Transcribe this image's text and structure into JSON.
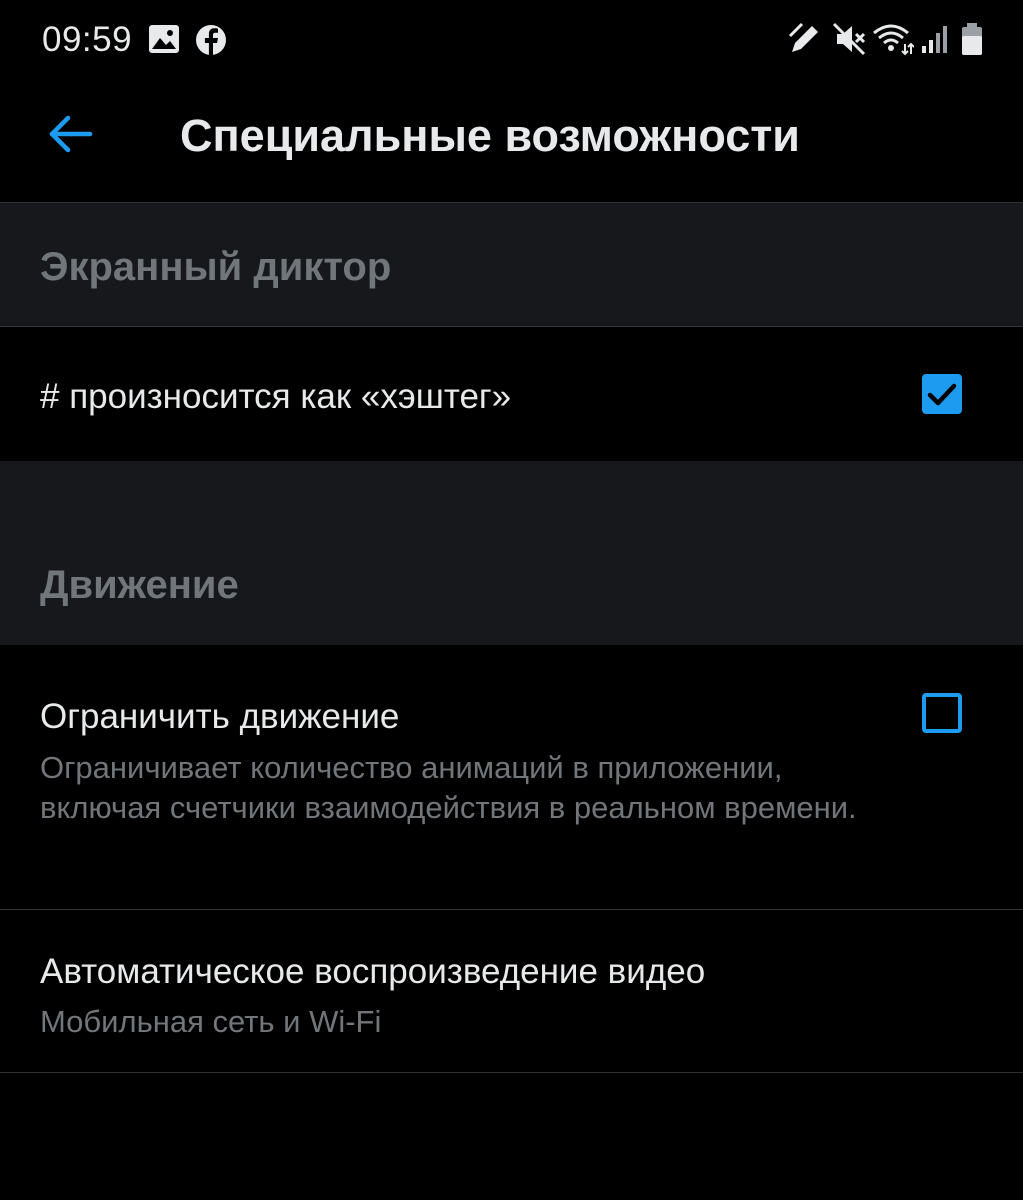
{
  "status_bar": {
    "time": "09:59",
    "left_icons": [
      "gallery-icon",
      "facebook-icon"
    ],
    "right_icons": [
      "pen-icon",
      "mute-icon",
      "wifi-icon",
      "signal-icon",
      "battery-icon"
    ]
  },
  "app_bar": {
    "title": "Специальные возможности",
    "back_icon": "arrow-left-icon"
  },
  "sections": [
    {
      "header": "Экранный диктор",
      "items": [
        {
          "title": "# произносится как «хэштег»",
          "checked": true
        }
      ]
    },
    {
      "header": "Движение",
      "items": [
        {
          "title": "Ограничить движение",
          "description": "Ограничивает количество анимаций в приложении, включая счетчики взаимодействия в реальном времени.",
          "checked": false
        },
        {
          "title": "Автоматическое воспроизведение видео",
          "description": "Мобильная сеть и Wi-Fi"
        }
      ]
    }
  ],
  "colors": {
    "accent": "#1d9bf0",
    "background": "#000000",
    "section_background": "#16181c",
    "primary_text": "#e7e9ea",
    "secondary_text": "#71767b",
    "divider": "#2f3336"
  }
}
